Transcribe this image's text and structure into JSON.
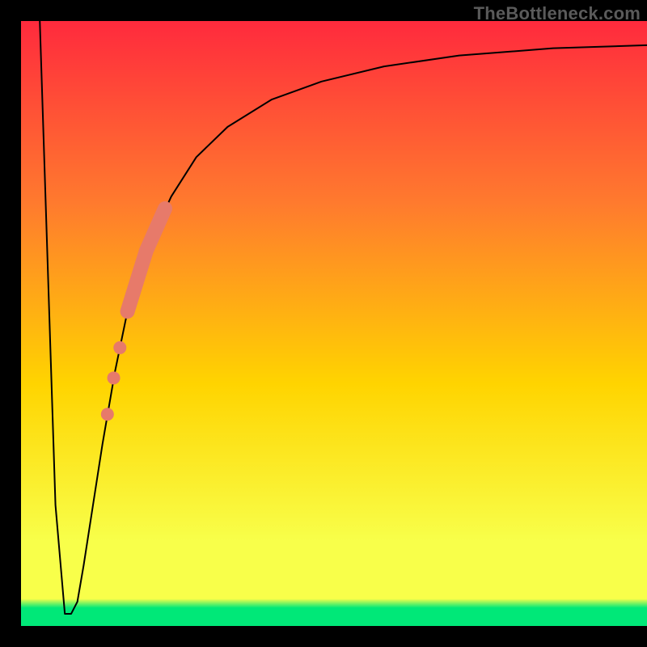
{
  "watermark": "TheBottleneck.com",
  "chart_data": {
    "type": "line",
    "title": "",
    "xlabel": "",
    "ylabel": "",
    "xlim": [
      0,
      100
    ],
    "ylim": [
      0,
      100
    ],
    "grid": false,
    "legend": false,
    "background_gradient": {
      "top_color": "#ff2a3d",
      "upper_middle_color": "#ff7a2e",
      "middle_color": "#ffd400",
      "lower_middle_color": "#f8ff4a",
      "bottom_color": "#00e878"
    },
    "frame_color": "#000000",
    "series": [
      {
        "name": "curve",
        "color": "#000000",
        "stroke_width": 2,
        "x": [
          3.0,
          5.5,
          7.0,
          8.0,
          9.0,
          10.0,
          11.5,
          13.0,
          15.0,
          17.0,
          20.0,
          24.0,
          28.0,
          33.0,
          40.0,
          48.0,
          58.0,
          70.0,
          85.0,
          100.0
        ],
        "y": [
          100.0,
          20.0,
          2.0,
          2.0,
          4.0,
          10.0,
          20.0,
          30.0,
          42.0,
          52.0,
          62.0,
          71.0,
          77.5,
          82.5,
          87.0,
          90.0,
          92.5,
          94.3,
          95.5,
          96.0
        ]
      }
    ],
    "highlight_segment": {
      "color": "#e77a6a",
      "stroke_width": 18,
      "x": [
        17.0,
        20.0,
        23.0
      ],
      "y": [
        52.0,
        62.0,
        69.0
      ]
    },
    "highlight_dots": {
      "color": "#e77a6a",
      "radius": 8,
      "points": [
        {
          "x": 15.8,
          "y": 46.0
        },
        {
          "x": 14.8,
          "y": 41.0
        },
        {
          "x": 13.8,
          "y": 35.0
        }
      ]
    }
  }
}
